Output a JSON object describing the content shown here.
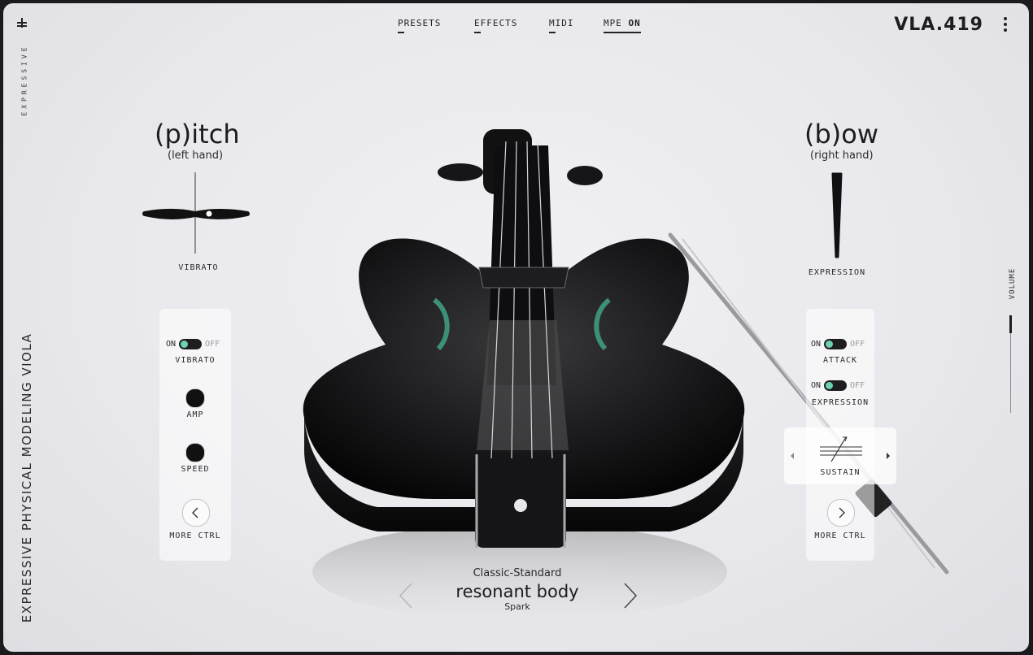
{
  "nav": {
    "presets": "PRESETS",
    "effects": "EFFECTS",
    "midi": "MIDI",
    "mpe_prefix": "MPE",
    "mpe_state": "ON"
  },
  "logo": "VLA.419",
  "brand": "EXPRESSIVE",
  "product_title": "EXPRESSIVE PHYSICAL MODELING VIOLA",
  "pitch": {
    "title": "(p)itch",
    "subtitle": "(left hand)",
    "xy_label": "VIBRATO",
    "panel": {
      "toggle_on": "ON",
      "toggle_off": "OFF",
      "toggle_label": "VIBRATO",
      "knob1_label": "AMP",
      "knob2_label": "SPEED",
      "more_label": "MORE CTRL"
    }
  },
  "bow": {
    "title": "(b)ow",
    "subtitle": "(right hand)",
    "meter_label": "EXPRESSION",
    "panel": {
      "toggle1_on": "ON",
      "toggle1_off": "OFF",
      "toggle1_label": "ATTACK",
      "toggle2_on": "ON",
      "toggle2_off": "OFF",
      "toggle2_label": "EXPRESSION",
      "mode_label": "SUSTAIN",
      "more_label": "MORE CTRL"
    }
  },
  "volume_label": "VOLUME",
  "preset": {
    "category": "Classic-Standard",
    "name": "resonant body",
    "author": "Spark"
  },
  "colors": {
    "accent": "#6fd1b3",
    "ink": "#1e1e20",
    "background": "#ececef"
  }
}
